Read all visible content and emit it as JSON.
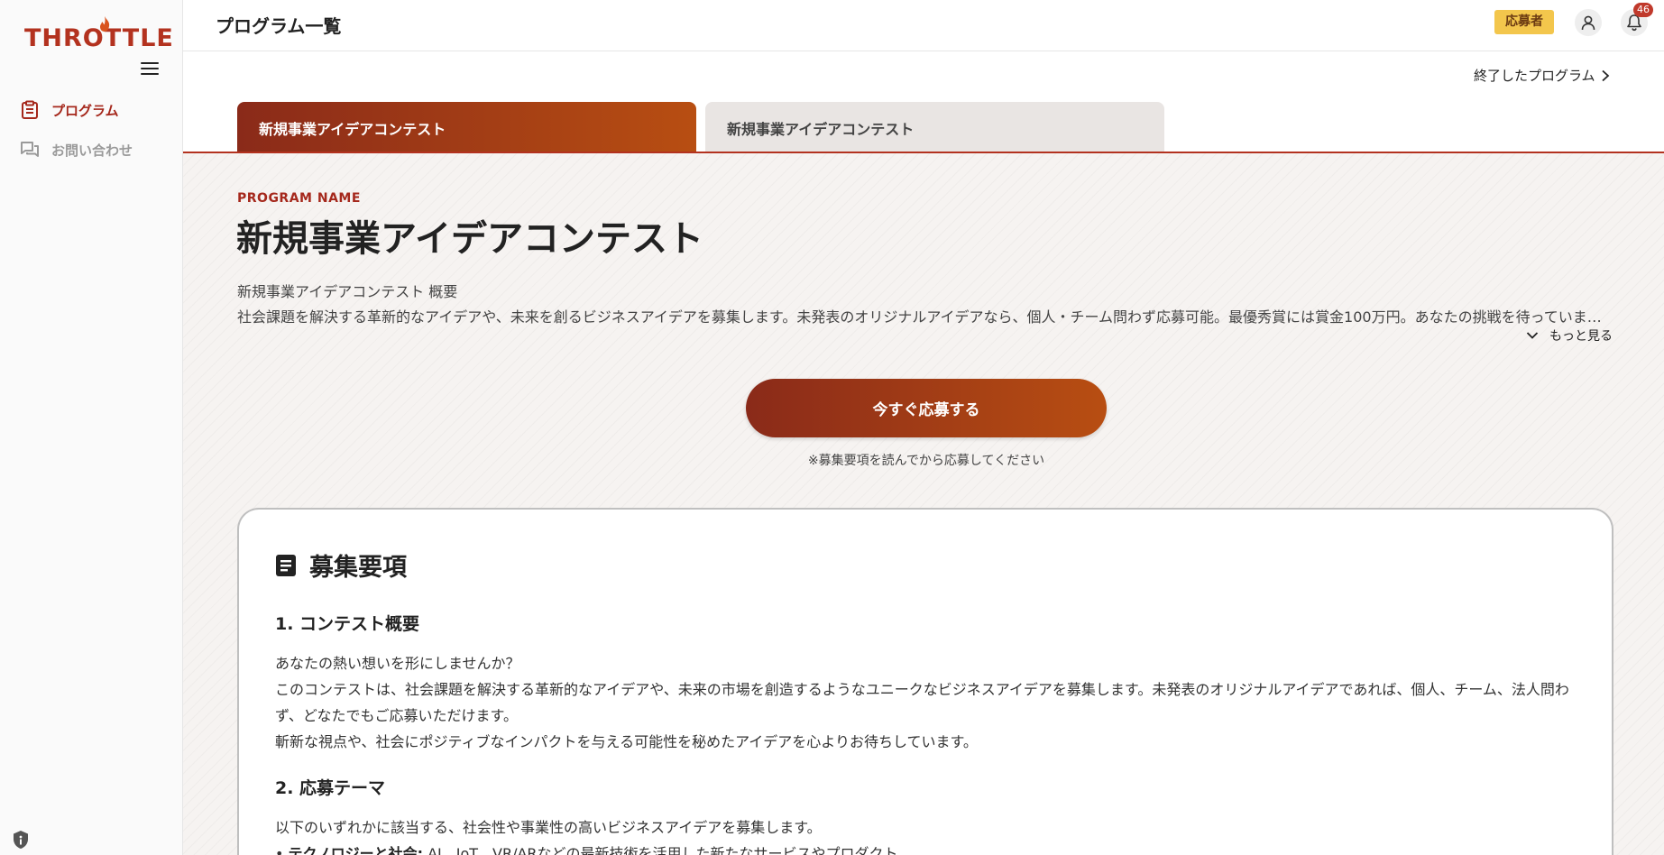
{
  "app": {
    "logo_text": "THROTTLE",
    "brand_color": "#b3321f"
  },
  "sidebar": {
    "items": [
      {
        "label": "プログラム",
        "icon": "clipboard-icon",
        "active": true
      },
      {
        "label": "お問い合わせ",
        "icon": "forum-icon",
        "active": false
      }
    ]
  },
  "header": {
    "title": "プログラム一覧",
    "role_badge": "応募者",
    "notification_count": "46"
  },
  "content": {
    "ended_programs_link": "終了したプログラム",
    "tabs": [
      {
        "label": "新規事業アイデアコンテスト",
        "active": true
      },
      {
        "label": "新規事業アイデアコンテスト",
        "active": false
      }
    ],
    "hero": {
      "program_name_label": "PROGRAM NAME",
      "program_title": "新規事業アイデアコンテスト",
      "summary_title": "新規事業アイデアコンテスト 概要",
      "summary_text": "社会課題を解決する革新的なアイデアや、未来を創るビジネスアイデアを募集します。未発表のオリジナルアイデアなら、個人・チーム問わず応募可能。最優秀賞には賞金100万円。あなたの挑戦を待っています。",
      "more_label": "もっと見る",
      "apply_button": "今すぐ応募する",
      "apply_note": "※募集要項を読んでから応募してください"
    },
    "guidelines": {
      "heading": "募集要項",
      "section1_title": "1. コンテスト概要",
      "section1_lines": [
        "あなたの熱い想いを形にしませんか？",
        "このコンテストは、社会課題を解決する革新的なアイデアや、未来の市場を創造するようなユニークなビジネスアイデアを募集します。未発表のオリジナルアイデアであれば、個人、チーム、法人問わず、どなたでもご応募いただけます。",
        "斬新な視点や、社会にポジティブなインパクトを与える可能性を秘めたアイデアを心よりお待ちしています。"
      ],
      "section2_title": "2. 応募テーマ",
      "section2_intro": "以下のいずれかに該当する、社会性や事業性の高いビジネスアイデアを募集します。",
      "bullet1_bold": "テクノロジーと社会:",
      "bullet1_text": " AI、IoT、VR/ARなどの最新技術を活用した新たなサービスやプロダクト"
    }
  }
}
